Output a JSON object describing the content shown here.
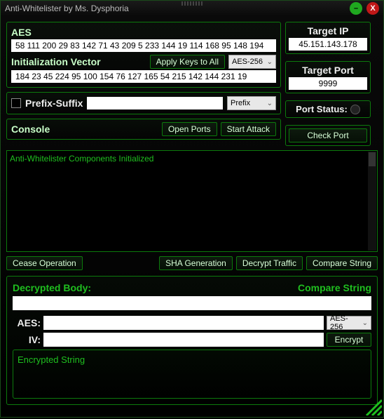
{
  "window": {
    "title": "Anti-Whitelister by Ms. Dysphoria"
  },
  "aes": {
    "label": "AES",
    "key": "58 111 200 29 83 142 71 43 209 5 233 144 19 114 168 95 148 194",
    "iv_label": "Initialization Vector",
    "iv": "184 23 45 224 95 100 154 76 127 165 54 215 142 144 231 19",
    "apply_btn": "Apply Keys to All",
    "mode": "AES-256"
  },
  "prefix": {
    "label": "Prefix-Suffix",
    "value": "",
    "mode": "Prefix"
  },
  "target": {
    "ip_label": "Target IP",
    "ip": "45.151.143.178",
    "port_label": "Target Port",
    "port": "9999",
    "status_label": "Port Status:",
    "check_btn": "Check Port"
  },
  "console": {
    "label": "Console",
    "open_ports_btn": "Open Ports",
    "start_attack_btn": "Start Attack",
    "line1": "Anti-Whitelister Components Initialized"
  },
  "actions": {
    "cease": "Cease Operation",
    "sha": "SHA Generation",
    "decrypt": "Decrypt Traffic",
    "compare": "Compare String"
  },
  "crypto": {
    "decrypted_label": "Decrypted Body:",
    "compare_label": "Compare String",
    "decrypted_value": "",
    "aes_label": "AES:",
    "aes_value": "",
    "aes_mode": "AES-256",
    "iv_label": "IV:",
    "iv_value": "",
    "encrypt_btn": "Encrypt",
    "encrypted_label": "Encrypted String",
    "encrypted_value": ""
  }
}
